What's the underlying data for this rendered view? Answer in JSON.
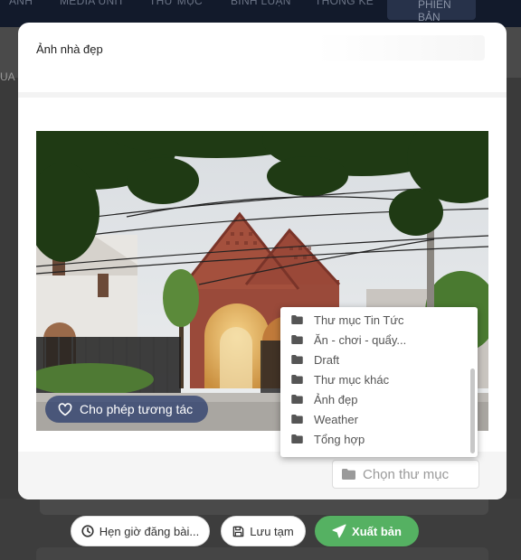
{
  "background_nav": {
    "items": [
      "ẢNH",
      "MEDIA UNIT",
      "THƯ MỤC",
      "BÌNH LUẬN",
      "THỐNG KÊ"
    ],
    "pill_label": "PHIÊN BẢN",
    "strip_fragment": "UA"
  },
  "modal": {
    "title": "Ảnh nhà đẹp",
    "image_alt": "Ảnh nhà đẹp",
    "allow_interaction_label": "Cho phép tương tác"
  },
  "folder_picker": {
    "placeholder": "Chọn thư mục",
    "options": [
      "Thư mục Tin Tức",
      "Ăn - chơi - quẩy...",
      "Draft",
      "Thư mục khác",
      "Ảnh đẹp",
      "Weather",
      "Tổng hợp"
    ]
  },
  "actions": {
    "schedule_label": "Hẹn giờ đăng bài...",
    "save_draft_label": "Lưu tạm",
    "publish_label": "Xuất bản"
  },
  "colors": {
    "publish": "#55b162",
    "nav_bg": "#121a2b",
    "pill_bg": "#2e406e"
  },
  "icons": {
    "heart": "heart-icon",
    "folder": "folder-icon",
    "clock": "clock-icon",
    "save": "save-icon",
    "send": "send-icon"
  }
}
